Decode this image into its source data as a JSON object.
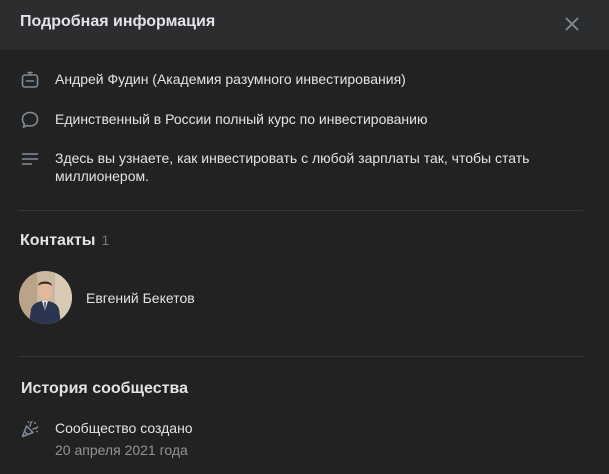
{
  "header": {
    "title": "Подробная информация"
  },
  "info": {
    "author": "Андрей Фудин (Академия разумного инвестирования)",
    "status": "Единственный в России полный курс по инвестированию",
    "description": "Здесь вы узнаете, как инвестировать с любой зарплаты так, чтобы стать миллионером."
  },
  "contacts": {
    "title": "Контакты",
    "count": "1",
    "items": [
      {
        "name": "Евгений Бекетов"
      }
    ]
  },
  "history": {
    "title": "История сообщества",
    "event": "Сообщество создано",
    "date": "20 апреля 2021 года"
  },
  "colors": {
    "background": "#222222",
    "header": "#2c2d2e",
    "text": "#e1e3e6",
    "muted": "#76787a",
    "icon": "#818c99"
  }
}
